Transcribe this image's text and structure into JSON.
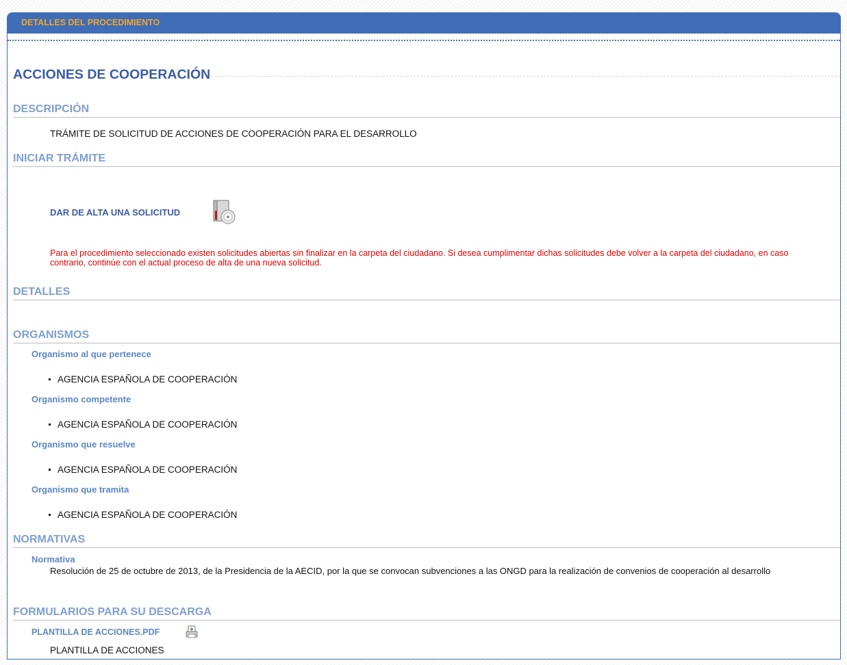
{
  "panel": {
    "header": "DETALLES DEL PROCEDIMIENTO"
  },
  "procedure": {
    "title": "ACCIONES DE COOPERACIÓN",
    "descripcion_heading": "DESCRIPCIÓN",
    "descripcion_text": "TRÁMITE DE SOLICITUD DE ACCIONES DE COOPERACIÓN PARA EL DESARROLLO",
    "iniciar_heading": "INICIAR TRÁMITE",
    "alta_link": "DAR DE ALTA UNA SOLICITUD",
    "alta_icon": "cd-case-icon",
    "warning": "Para el procedimiento seleccionado existen solicitudes abiertas sin finalizar en la carpeta del ciudadano. Si desea cumplimentar dichas solicitudes debe volver a la carpeta del ciudadano, en caso contrario, continúe con el actual proceso de alta de una nueva solicitud.",
    "detalles_heading": "DETALLES"
  },
  "organismos": {
    "heading": "ORGANISMOS",
    "groups": [
      {
        "label": "Organismo al que pertenece",
        "value": "AGENCIA ESPAÑOLA DE COOPERACIÓN"
      },
      {
        "label": "Organismo competente",
        "value": "AGENCIA ESPAÑOLA DE COOPERACIÓN"
      },
      {
        "label": "Organismo que resuelve",
        "value": "AGENCIA ESPAÑOLA DE COOPERACIÓN"
      },
      {
        "label": "Organismo que tramita",
        "value": "AGENCIA ESPAÑOLA DE COOPERACIÓN"
      }
    ]
  },
  "normativas": {
    "heading": "NORMATIVAS",
    "label": "Normativa",
    "text": "Resolución de 25 de octubre de 2013, de la Presidencia de la AECID, por la que se convocan subvenciones a las ONGD para la realización de convenios de cooperación al desarrollo"
  },
  "formularios": {
    "heading": "FORMULARIOS PARA SU DESCARGA",
    "file_link": "PLANTILLA DE ACCIONES.PDF",
    "file_desc": "PLANTILLA DE ACCIONES",
    "icon": "printer-download-icon"
  },
  "colors": {
    "accent": "#3f6db7",
    "header_text": "#f5a623",
    "warning": "#e00000",
    "section": "#7e9fd1"
  }
}
